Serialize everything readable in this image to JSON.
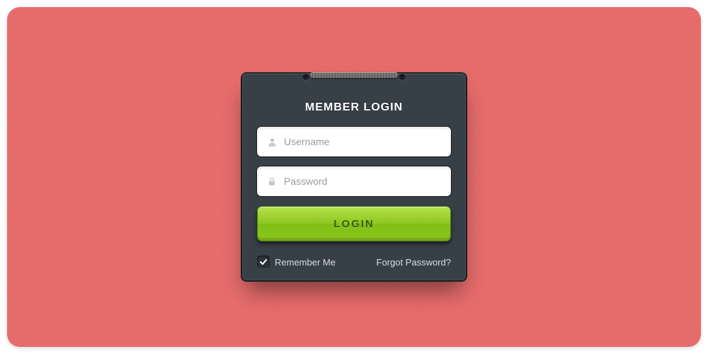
{
  "title": "MEMBER LOGIN",
  "fields": {
    "username": {
      "placeholder": "Username",
      "value": ""
    },
    "password": {
      "placeholder": "Password",
      "value": ""
    }
  },
  "login_button_label": "LOGIN",
  "remember": {
    "label": "Remember Me",
    "checked": true
  },
  "forgot_label": "Forgot Password?",
  "colors": {
    "background": "#e66a6a",
    "panel": "#373f47",
    "accent": "#8cc71f"
  }
}
